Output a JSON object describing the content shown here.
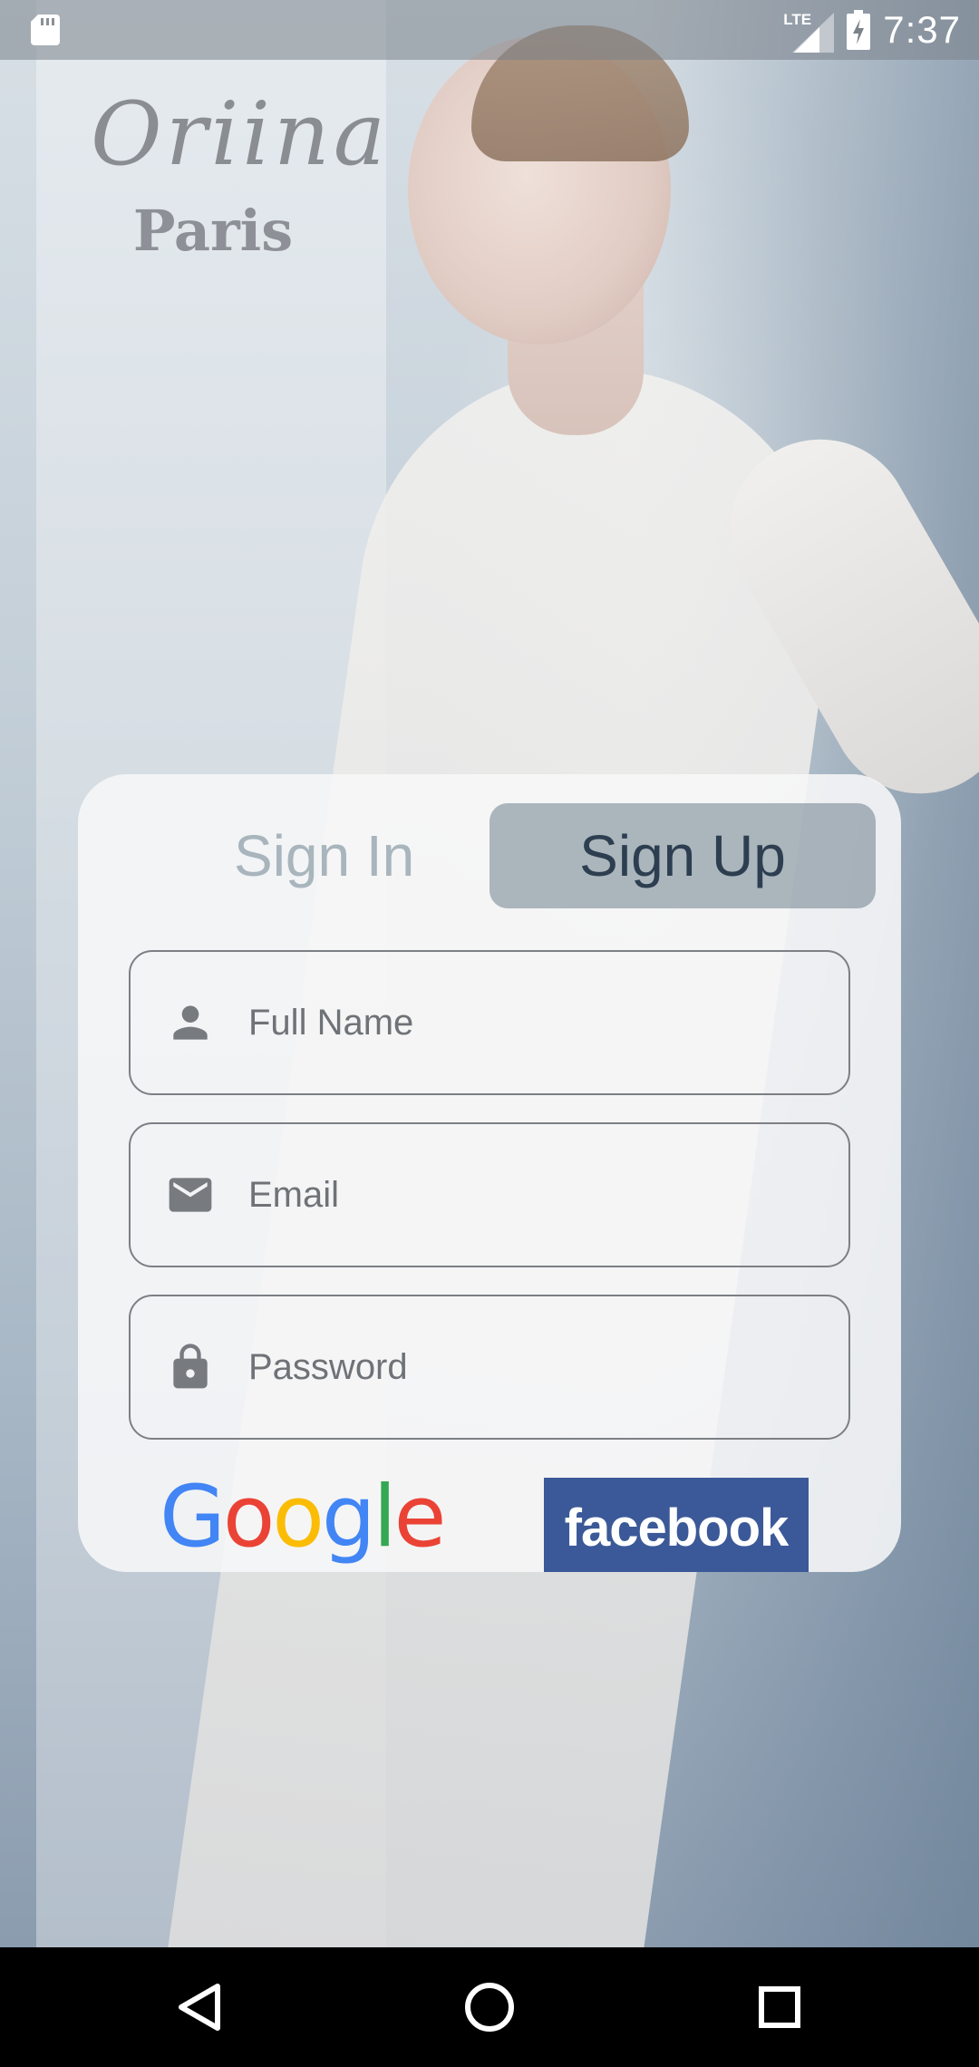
{
  "status_bar": {
    "time": "7:37",
    "network": "LTE"
  },
  "brand": {
    "name": "Oriina",
    "city": "Paris"
  },
  "tabs": {
    "sign_in": "Sign In",
    "sign_up": "Sign Up",
    "active": "sign_up"
  },
  "form": {
    "full_name_placeholder": "Full Name",
    "email_placeholder": "Email",
    "password_placeholder": "Password"
  },
  "social": {
    "google_label": "Google",
    "facebook_label": "facebook"
  },
  "icons": {
    "sd_card": "sd-card-icon",
    "signal": "lte-signal-icon",
    "battery": "battery-charging-icon",
    "person": "person-icon",
    "email": "mail-icon",
    "lock": "lock-icon",
    "back": "back-triangle-icon",
    "home": "home-circle-icon",
    "recent": "recent-square-icon"
  },
  "colors": {
    "active_tab_text": "#2d3e50",
    "inactive_tab_text": "#a8b5bc",
    "facebook_blue": "#3b5998",
    "google_blue": "#4285F4",
    "google_red": "#EA4335",
    "google_yellow": "#FBBC05",
    "google_green": "#34A853"
  }
}
